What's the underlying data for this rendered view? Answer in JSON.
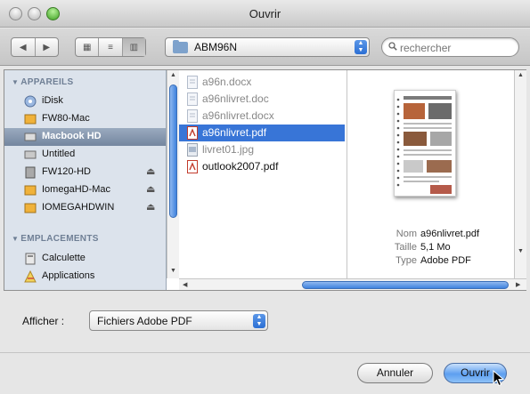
{
  "window": {
    "title": "Ouvrir"
  },
  "toolbar": {
    "back_label": "◀",
    "forward_label": "▶",
    "view_icon_label": "▦",
    "view_list_label": "≡",
    "view_column_label": "▥",
    "current_folder": "ABM96N",
    "search_placeholder": "rechercher"
  },
  "sidebar": {
    "devices_header": "APPAREILS",
    "devices": [
      {
        "label": "iDisk",
        "icon": "idisk-icon"
      },
      {
        "label": "FW80-Mac",
        "icon": "drive-icon"
      },
      {
        "label": "Macbook HD",
        "icon": "internal-drive-icon",
        "selected": true
      },
      {
        "label": "Untitled",
        "icon": "disk-icon"
      },
      {
        "label": "FW120-HD",
        "icon": "external-drive-icon",
        "eject": "⏏"
      },
      {
        "label": "IomegaHD-Mac",
        "icon": "drive-icon",
        "eject": "⏏"
      },
      {
        "label": "IOMEGAHDWIN",
        "icon": "drive-icon",
        "eject": "⏏"
      }
    ],
    "places_header": "EMPLACEMENTS",
    "places": [
      {
        "label": "Calculette",
        "icon": "calculator-icon"
      },
      {
        "label": "Applications",
        "icon": "applications-icon"
      }
    ]
  },
  "files": [
    {
      "name": "a96n.docx",
      "enabled": false
    },
    {
      "name": "a96nlivret.doc",
      "enabled": false
    },
    {
      "name": "a96nlivret.docx",
      "enabled": false
    },
    {
      "name": "a96nlivret.pdf",
      "enabled": true,
      "selected": true
    },
    {
      "name": "livret01.jpg",
      "enabled": false
    },
    {
      "name": "outlook2007.pdf",
      "enabled": true
    }
  ],
  "preview": {
    "name_key": "Nom",
    "name_value": "a96nlivret.pdf",
    "size_key": "Taille",
    "size_value": "5,1 Mo",
    "type_key": "Type",
    "type_value": "Adobe PDF"
  },
  "bottom": {
    "filter_label": "Afficher :",
    "filter_value": "Fichiers Adobe PDF",
    "cancel_label": "Annuler",
    "open_label": "Ouvrir"
  },
  "colors": {
    "selection": "#3875d7",
    "sidebar_bg": "#dce3ec",
    "scroll_thumb": "#3f82de"
  }
}
